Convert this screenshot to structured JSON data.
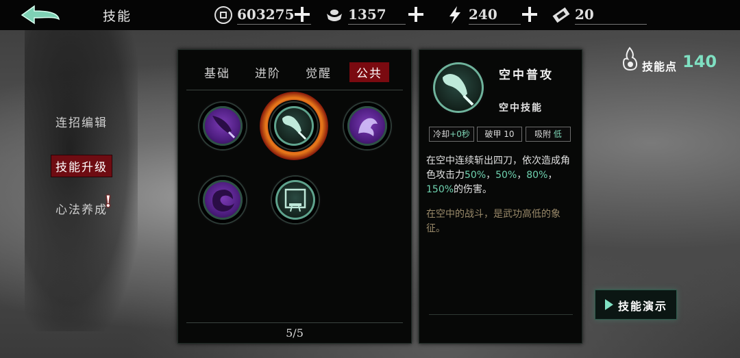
{
  "header": {
    "title": "技能",
    "resources": [
      {
        "icon": "coin-icon",
        "value": "603275"
      },
      {
        "icon": "silver-ingot-icon",
        "value": "1357"
      },
      {
        "icon": "lightning-energy-icon",
        "value": "240"
      },
      {
        "icon": "ticket-icon",
        "value": "20"
      }
    ]
  },
  "sidebar": {
    "items": [
      {
        "label": "连招编辑",
        "active": false
      },
      {
        "label": "技能升级",
        "active": true
      },
      {
        "label": "心法养成",
        "active": false,
        "badge": "!"
      }
    ]
  },
  "skill_panel": {
    "tabs": [
      {
        "label": "基础",
        "active": false
      },
      {
        "label": "进阶",
        "active": false
      },
      {
        "label": "觉醒",
        "active": false
      },
      {
        "label": "公共",
        "active": true
      }
    ],
    "skills": [
      {
        "icon": "purple-sword-skill-icon",
        "color": "purple"
      },
      {
        "icon": "air-sword-skill-icon",
        "color": "teal",
        "selected": true
      },
      {
        "icon": "purple-beast-skill-icon",
        "color": "purple"
      },
      {
        "icon": "purple-whirl-skill-icon",
        "color": "purple"
      },
      {
        "icon": "teal-banner-skill-icon",
        "color": "teal"
      }
    ],
    "pager": "5/5"
  },
  "detail": {
    "name": "空中普攻",
    "type": "空中技能",
    "stats": [
      {
        "label": "冷却",
        "value": "+0秒"
      },
      {
        "label": "破甲",
        "value": "10"
      },
      {
        "label": "吸附",
        "value": "低"
      }
    ],
    "description_parts": {
      "prefix": "在空中连续斩出四刀，依次造成角色攻击力",
      "v1": "50%",
      "sep1": "，",
      "v2": "50%",
      "sep2": "，",
      "v3": "80%",
      "sep3": "，",
      "v4": "150%",
      "suffix": "的伤害。"
    },
    "flavor": "在空中的战斗，是武功高低的象征。"
  },
  "skill_points": {
    "label": "技能点",
    "value": "140"
  },
  "demo_button": {
    "label": "技能演示"
  },
  "colors": {
    "accent_teal": "#7fe0c2",
    "tab_active_red": "#7a0a10",
    "flavor_text": "#9a8a6a"
  }
}
